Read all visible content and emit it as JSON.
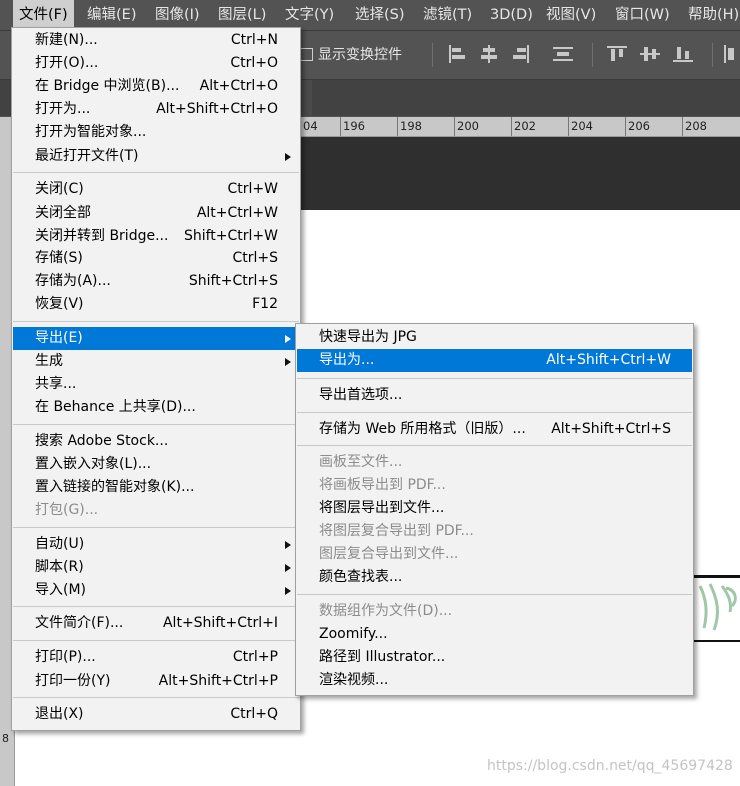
{
  "menubar": [
    {
      "label": "文件(F)",
      "active": true
    },
    {
      "label": "编辑(E)"
    },
    {
      "label": "图像(I)"
    },
    {
      "label": "图层(L)"
    },
    {
      "label": "文字(Y)"
    },
    {
      "label": "选择(S)"
    },
    {
      "label": "滤镜(T)"
    },
    {
      "label": "3D(D)"
    },
    {
      "label": "视图(V)"
    },
    {
      "label": "窗口(W)"
    },
    {
      "label": "帮助(H)"
    }
  ],
  "options_bar": {
    "show_transform_controls_label": "显示变换控件",
    "show_transform_controls_checked": false
  },
  "ruler": {
    "labels": [
      "04",
      "196",
      "198",
      "200",
      "202",
      "204",
      "206",
      "208"
    ],
    "vertical_label": "8"
  },
  "file_menu": [
    {
      "label": "新建(N)...",
      "shortcut": "Ctrl+N"
    },
    {
      "label": "打开(O)...",
      "shortcut": "Ctrl+O"
    },
    {
      "label": "在 Bridge 中浏览(B)...",
      "shortcut": "Alt+Ctrl+O"
    },
    {
      "label": "打开为...",
      "shortcut": "Alt+Shift+Ctrl+O"
    },
    {
      "label": "打开为智能对象...",
      "shortcut": ""
    },
    {
      "label": "最近打开文件(T)",
      "shortcut": "",
      "submenu": true
    },
    {
      "divider": true
    },
    {
      "label": "关闭(C)",
      "shortcut": "Ctrl+W"
    },
    {
      "label": "关闭全部",
      "shortcut": "Alt+Ctrl+W"
    },
    {
      "label": "关闭并转到 Bridge...",
      "shortcut": "Shift+Ctrl+W"
    },
    {
      "label": "存储(S)",
      "shortcut": "Ctrl+S"
    },
    {
      "label": "存储为(A)...",
      "shortcut": "Shift+Ctrl+S"
    },
    {
      "label": "恢复(V)",
      "shortcut": "F12"
    },
    {
      "divider": true
    },
    {
      "label": "导出(E)",
      "shortcut": "",
      "submenu": true,
      "highlighted": true
    },
    {
      "label": "生成",
      "shortcut": "",
      "submenu": true
    },
    {
      "label": "共享...",
      "shortcut": ""
    },
    {
      "label": "在 Behance 上共享(D)...",
      "shortcut": ""
    },
    {
      "divider": true
    },
    {
      "label": "搜索 Adobe Stock...",
      "shortcut": ""
    },
    {
      "label": "置入嵌入对象(L)...",
      "shortcut": ""
    },
    {
      "label": "置入链接的智能对象(K)...",
      "shortcut": ""
    },
    {
      "label": "打包(G)...",
      "shortcut": "",
      "disabled": true
    },
    {
      "divider": true
    },
    {
      "label": "自动(U)",
      "shortcut": "",
      "submenu": true
    },
    {
      "label": "脚本(R)",
      "shortcut": "",
      "submenu": true
    },
    {
      "label": "导入(M)",
      "shortcut": "",
      "submenu": true
    },
    {
      "divider": true
    },
    {
      "label": "文件简介(F)...",
      "shortcut": "Alt+Shift+Ctrl+I"
    },
    {
      "divider": true
    },
    {
      "label": "打印(P)...",
      "shortcut": "Ctrl+P"
    },
    {
      "label": "打印一份(Y)",
      "shortcut": "Alt+Shift+Ctrl+P"
    },
    {
      "divider": true
    },
    {
      "label": "退出(X)",
      "shortcut": "Ctrl+Q"
    }
  ],
  "export_menu": [
    {
      "label": "快速导出为 JPG",
      "shortcut": ""
    },
    {
      "label": "导出为...",
      "shortcut": "Alt+Shift+Ctrl+W",
      "highlighted": true
    },
    {
      "divider": true
    },
    {
      "label": "导出首选项...",
      "shortcut": ""
    },
    {
      "divider": true
    },
    {
      "label": "存储为 Web 所用格式（旧版）...",
      "shortcut": "Alt+Shift+Ctrl+S"
    },
    {
      "divider": true
    },
    {
      "label": "画板至文件...",
      "shortcut": "",
      "disabled": true
    },
    {
      "label": "将画板导出到 PDF...",
      "shortcut": "",
      "disabled": true
    },
    {
      "label": "将图层导出到文件...",
      "shortcut": ""
    },
    {
      "label": "将图层复合导出到 PDF...",
      "shortcut": "",
      "disabled": true
    },
    {
      "label": "图层复合导出到文件...",
      "shortcut": "",
      "disabled": true
    },
    {
      "label": "颜色查找表...",
      "shortcut": ""
    },
    {
      "divider": true
    },
    {
      "label": "数据组作为文件(D)...",
      "shortcut": "",
      "disabled": true
    },
    {
      "label": "Zoomify...",
      "shortcut": ""
    },
    {
      "label": "路径到 Illustrator...",
      "shortcut": ""
    },
    {
      "label": "渲染视频...",
      "shortcut": ""
    }
  ],
  "watermark": "https://blog.csdn.net/qq_45697428",
  "colors": {
    "highlight": "#0078d7",
    "menu_bg": "#f2f2f2",
    "chrome_bg": "#535353",
    "graphic_green": "#9fc7a8"
  }
}
